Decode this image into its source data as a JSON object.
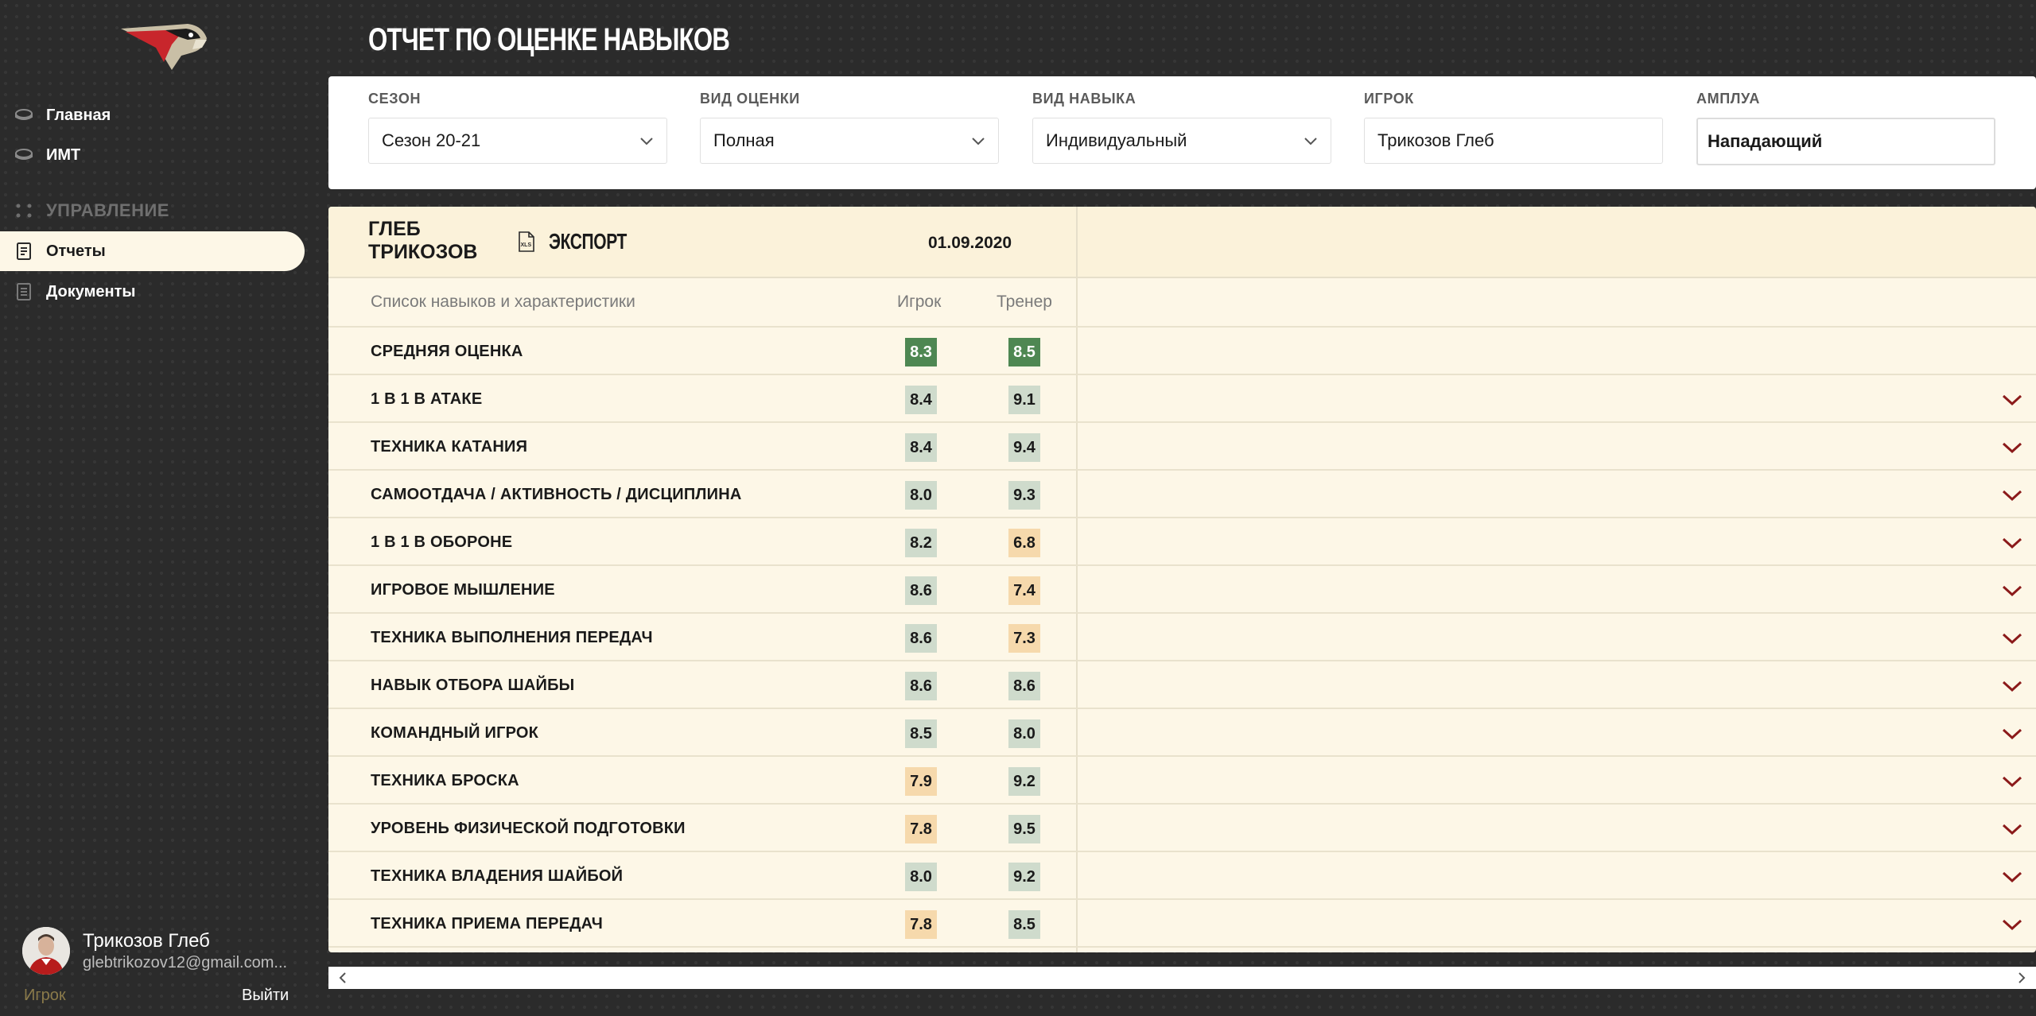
{
  "sidebar": {
    "nav": [
      {
        "label": "Главная",
        "icon": "puck-icon"
      },
      {
        "label": "ИМТ",
        "icon": "puck-icon"
      }
    ],
    "section_label": "УПРАВЛЕНИЕ",
    "section_items": [
      {
        "label": "Отчеты",
        "icon": "report-icon",
        "active": true
      },
      {
        "label": "Документы",
        "icon": "document-icon"
      }
    ],
    "user": {
      "name": "Трикозов Глеб",
      "email": "glebtrikozov12@gmail.com...",
      "role": "Игрок",
      "logout": "Выйти"
    }
  },
  "page": {
    "title": "ОТЧЕТ ПО ОЦЕНКЕ НАВЫКОВ"
  },
  "filters": {
    "season": {
      "label": "СЕЗОН",
      "value": "Сезон 20-21"
    },
    "eval_type": {
      "label": "ВИД ОЦЕНКИ",
      "value": "Полная"
    },
    "skill_type": {
      "label": "ВИД НАВЫКА",
      "value": "Индивидуальный"
    },
    "player": {
      "label": "ИГРОК",
      "value": "Трикозов Глеб"
    },
    "role": {
      "label": "АМПЛУА",
      "value": "Нападающий"
    }
  },
  "report": {
    "player_name": "ГЛЕБ ТРИКОЗОВ",
    "export_label": "ЭКСПОРТ",
    "date": "01.09.2020",
    "columns": {
      "skill": "Список навыков и характеристики",
      "player": "Игрок",
      "coach": "Тренер"
    },
    "rows": [
      {
        "skill": "СРЕДНЯЯ ОЦЕНКА",
        "player": "8.3",
        "coach": "8.5",
        "player_style": "green",
        "coach_style": "green",
        "expandable": false
      },
      {
        "skill": "1 В 1 В АТАКЕ",
        "player": "8.4",
        "coach": "9.1",
        "player_style": "light",
        "coach_style": "light",
        "expandable": true
      },
      {
        "skill": "ТЕХНИКА КАТАНИЯ",
        "player": "8.4",
        "coach": "9.4",
        "player_style": "light",
        "coach_style": "light",
        "expandable": true
      },
      {
        "skill": "САМООТДАЧА / АКТИВНОСТЬ / ДИСЦИПЛИНА",
        "player": "8.0",
        "coach": "9.3",
        "player_style": "light",
        "coach_style": "light",
        "expandable": true
      },
      {
        "skill": "1 В 1 В ОБОРОНЕ",
        "player": "8.2",
        "coach": "6.8",
        "player_style": "light",
        "coach_style": "orange",
        "expandable": true
      },
      {
        "skill": "ИГРОВОЕ МЫШЛЕНИЕ",
        "player": "8.6",
        "coach": "7.4",
        "player_style": "light",
        "coach_style": "orange",
        "expandable": true
      },
      {
        "skill": "ТЕХНИКА ВЫПОЛНЕНИЯ ПЕРЕДАЧ",
        "player": "8.6",
        "coach": "7.3",
        "player_style": "light",
        "coach_style": "orange",
        "expandable": true
      },
      {
        "skill": "НАВЫК ОТБОРА ШАЙБЫ",
        "player": "8.6",
        "coach": "8.6",
        "player_style": "light",
        "coach_style": "light",
        "expandable": true
      },
      {
        "skill": "КОМАНДНЫЙ ИГРОК",
        "player": "8.5",
        "coach": "8.0",
        "player_style": "light",
        "coach_style": "light",
        "expandable": true
      },
      {
        "skill": "ТЕХНИКА БРОСКА",
        "player": "7.9",
        "coach": "9.2",
        "player_style": "orange",
        "coach_style": "light",
        "expandable": true
      },
      {
        "skill": "УРОВЕНЬ ФИЗИЧЕСКОЙ ПОДГОТОВКИ",
        "player": "7.8",
        "coach": "9.5",
        "player_style": "orange",
        "coach_style": "light",
        "expandable": true
      },
      {
        "skill": "ТЕХНИКА ВЛАДЕНИЯ ШАЙБОЙ",
        "player": "8.0",
        "coach": "9.2",
        "player_style": "light",
        "coach_style": "light",
        "expandable": true
      },
      {
        "skill": "ТЕХНИКА ПРИЕМА ПЕРЕДАЧ",
        "player": "7.8",
        "coach": "8.5",
        "player_style": "orange",
        "coach_style": "light",
        "expandable": true
      }
    ]
  },
  "colors": {
    "background": "#2b2b2b",
    "panel": "#fdf7e7",
    "green_badge": "#4e8752",
    "light_badge": "#cfdbcc",
    "orange_badge": "#f6d9ac",
    "accent_red": "#8b1a1a"
  }
}
